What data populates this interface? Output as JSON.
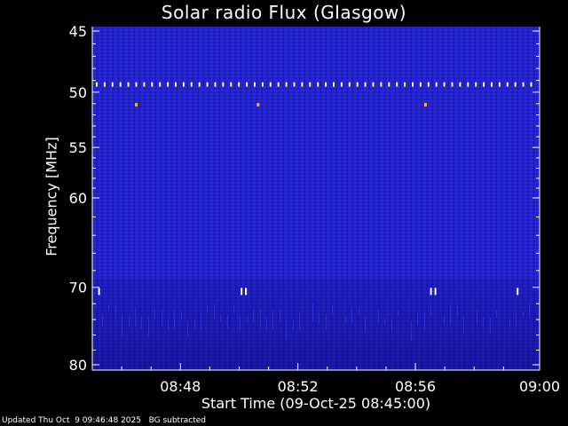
{
  "chart_data": {
    "type": "heatmap",
    "title": "Solar radio Flux (Glasgow)",
    "ylabel": "Frequency [MHz]",
    "xlabel": "Start Time (09-Oct-25 08:45:00)",
    "y_scale": "log",
    "ylim": [
      45,
      80
    ],
    "y_ticks": [
      45,
      50,
      55,
      60,
      70,
      80
    ],
    "y_tick_labels": [
      "45",
      "50",
      "55",
      "60",
      "70",
      "80"
    ],
    "x_ticks_minutes": [
      3,
      7,
      11,
      15
    ],
    "x_tick_labels": [
      "08:48",
      "08:52",
      "08:56",
      "09:00"
    ],
    "xlim_minutes": [
      0,
      15
    ],
    "colors": {
      "background": "#2020c8",
      "lower_band": "#1c1cae",
      "interference": "#ffff80",
      "spike": "#ffffff",
      "axis": "#ffffff"
    },
    "features": {
      "interference_line_mhz": 49.3,
      "dots_mhz": 51.1,
      "dots_minutes": [
        1.45,
        5.6,
        11.3
      ],
      "spikes_mhz": 70.5,
      "spikes_minutes": [
        0.2,
        5.05,
        5.2,
        11.5,
        11.65,
        14.45
      ]
    }
  },
  "footer": {
    "updated": "Updated Thu Oct  9 09:46:48 2025",
    "note": "BG subtracted"
  }
}
